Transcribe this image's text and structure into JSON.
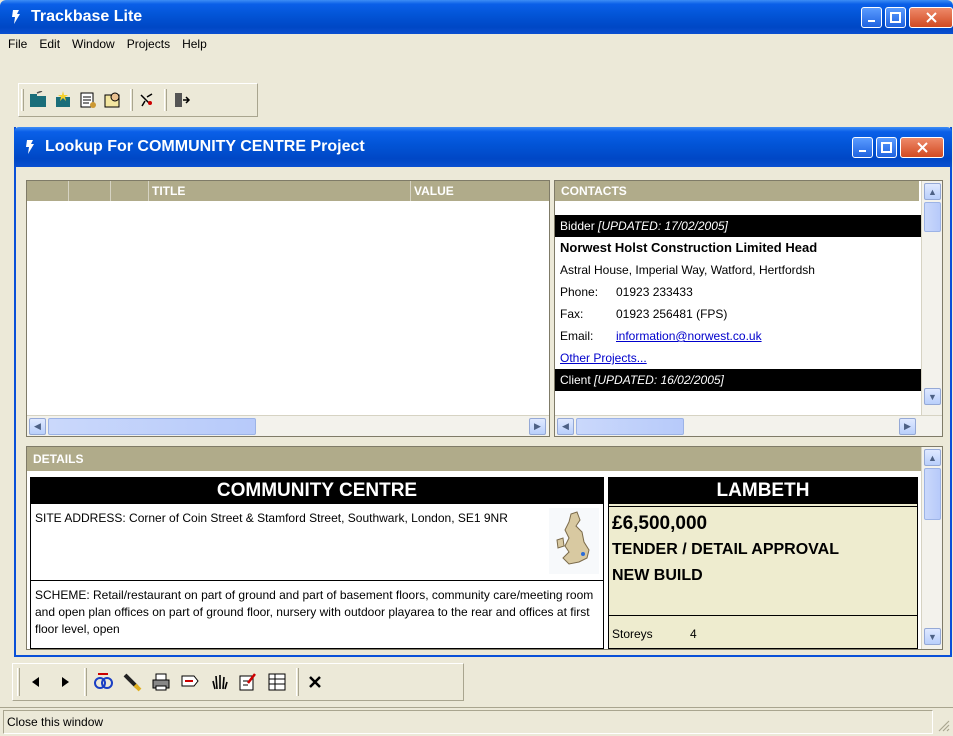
{
  "app": {
    "title": "Trackbase Lite"
  },
  "menu": [
    "File",
    "Edit",
    "Window",
    "Projects",
    "Help"
  ],
  "toolbar_icons": [
    "project-icon",
    "new-project-icon",
    "report-icon",
    "contacts-icon",
    "pin-icon",
    "exit-icon"
  ],
  "inner_window": {
    "title": "Lookup For COMMUNITY CENTRE Project"
  },
  "grid": {
    "columns": [
      "",
      "",
      "",
      "TITLE",
      "VALUE"
    ],
    "rows": []
  },
  "contacts": {
    "header": "CONTACTS",
    "bidder_label": "Bidder",
    "bidder_updated": "[UPDATED: 17/02/2005]",
    "company": "Norwest Holst Construction Limited Head",
    "address": "Astral House, Imperial Way, Watford, Hertfordsh",
    "phone_label": "Phone:",
    "phone": "01923 233433",
    "fax_label": "Fax:",
    "fax": "01923 256481 (FPS)",
    "email_label": "Email:",
    "email": "information@norwest.co.uk",
    "other_projects": "Other Projects...",
    "client_label": "Client",
    "client_updated": "[UPDATED: 16/02/2005]"
  },
  "details": {
    "header": "DETAILS",
    "project_title": "COMMUNITY CENTRE",
    "site_address": "SITE ADDRESS: Corner of Coin Street & Stamford Street, Southwark, London, SE1 9NR",
    "scheme": "SCHEME: Retail/restaurant on part of ground and part of  basement floors, community care/meeting room and  open plan offices on part of ground floor, nursery with outdoor playarea to the rear and  offices at first floor level, open",
    "region": "LAMBETH",
    "value": "£6,500,000",
    "stage": "TENDER / DETAIL APPROVAL",
    "type": "NEW BUILD",
    "storeys_label": "Storeys",
    "storeys": "4"
  },
  "bottom_toolbar_icons": [
    "previous-icon",
    "next-icon",
    "search-icon",
    "highlight-icon",
    "print-icon",
    "tag-icon",
    "hand-icon",
    "edit-icon",
    "table-icon",
    "close-icon"
  ],
  "status": {
    "text": "Close this window"
  }
}
